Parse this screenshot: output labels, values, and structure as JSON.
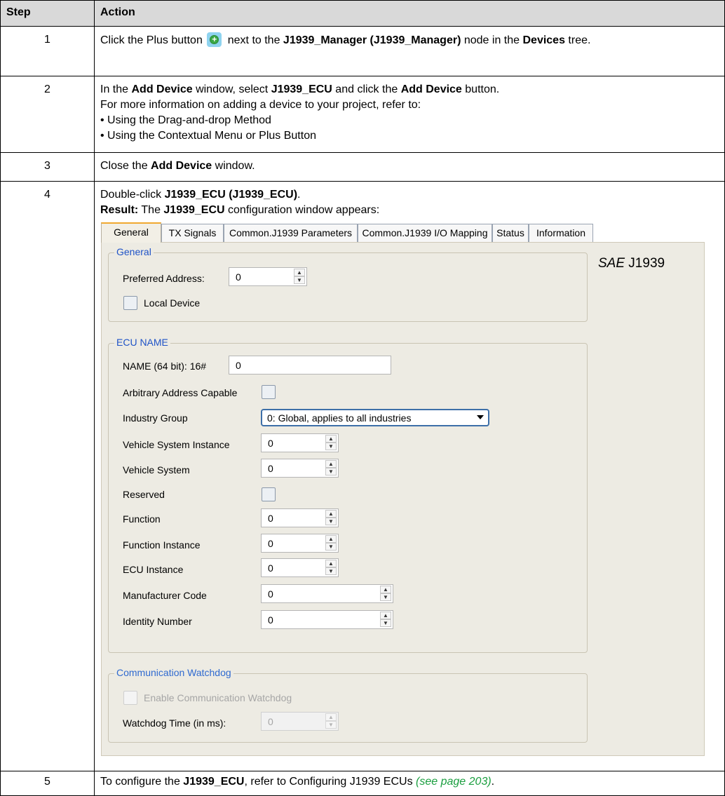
{
  "table": {
    "header_step": "Step",
    "header_action": "Action"
  },
  "rows": {
    "r1": {
      "num": "1",
      "t1": "Click the Plus button",
      "t2": " next to the ",
      "b1": "J1939_Manager (J1939_Manager)",
      "t3": " node in the ",
      "b2": "Devices",
      "t4": " tree."
    },
    "r2": {
      "num": "2",
      "t1": "In the ",
      "b1": "Add Device",
      "t2": " window, select ",
      "b2": "J1939_ECU",
      "t3": " and click the ",
      "b3": "Add Device",
      "t4": " button.",
      "line2": "For more information on adding a device to your project, refer to:",
      "line3": "• Using the Drag-and-drop Method",
      "line4": "• Using the Contextual Menu or Plus Button"
    },
    "r3": {
      "num": "3",
      "t1": "Close the ",
      "b1": "Add Device",
      "t2": " window."
    },
    "r4": {
      "num": "4",
      "t1": "Double-click ",
      "b1": "J1939_ECU (J1939_ECU)",
      "t2": ".",
      "b2": "Result:",
      "t3": " The ",
      "b3": "J1939_ECU",
      "t4": " configuration window appears:"
    },
    "r5": {
      "num": "5",
      "t1": "To configure the ",
      "b1": "J1939_ECU",
      "t2": ", refer to Configuring J1939 ECUs ",
      "link": "(see page 203)",
      "t3": "."
    }
  },
  "window": {
    "tabs": [
      "General",
      "TX Signals",
      "Common.J1939 Parameters",
      "Common.J1939 I/O Mapping",
      "Status",
      "Information"
    ],
    "active_tab": "General",
    "sae_italic": "SAE",
    "sae_rest": " J1939",
    "general_group": {
      "title": "General",
      "preferred_address_label": "Preferred Address:",
      "preferred_address_value": "0",
      "local_device_label": "Local Device",
      "local_device_checked": false
    },
    "ecu_name_group": {
      "title": "ECU NAME",
      "name_label": "NAME (64 bit): 16#",
      "name_value": "0",
      "arbitrary_label": "Arbitrary Address Capable",
      "arbitrary_checked": false,
      "industry_group_label": "Industry Group",
      "industry_group_value": "0: Global, applies to all industries",
      "vehicle_system_instance_label": "Vehicle System Instance",
      "vehicle_system_instance_value": "0",
      "vehicle_system_label": "Vehicle System",
      "vehicle_system_value": "0",
      "reserved_label": "Reserved",
      "reserved_checked": false,
      "function_label": "Function",
      "function_value": "0",
      "function_instance_label": "Function Instance",
      "function_instance_value": "0",
      "ecu_instance_label": "ECU Instance",
      "ecu_instance_value": "0",
      "manufacturer_code_label": "Manufacturer Code",
      "manufacturer_code_value": "0",
      "identity_number_label": "Identity Number",
      "identity_number_value": "0"
    },
    "watchdog_group": {
      "title": "Communication Watchdog",
      "enable_label": "Enable Communication Watchdog",
      "enable_checked": false,
      "time_label": "Watchdog Time (in ms):",
      "time_value": "0"
    }
  },
  "icons": {
    "plus": "plus-button-icon",
    "spin_up": "spin-up-icon",
    "spin_down": "spin-down-icon",
    "dropdown": "chevron-down-icon"
  },
  "colors": {
    "header_bg": "#d9d9d9",
    "group_title": "#1f53c7",
    "active_tab_accent": "#f0a830",
    "link": "#1a9e3f",
    "panel_bg": "#edebe3"
  }
}
